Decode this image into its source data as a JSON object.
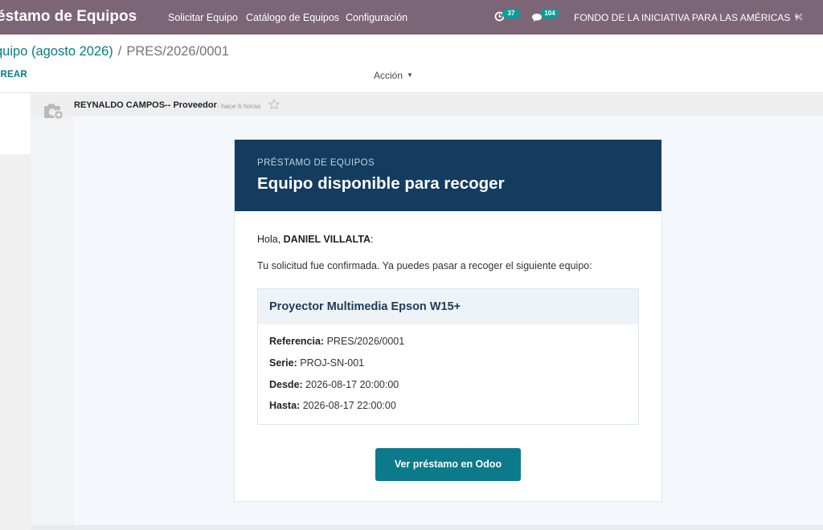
{
  "navbar": {
    "app_title": "éstamo de Equipos",
    "menu": [
      "Solicitar Equipo",
      "Catálogo de Equipos",
      "Configuración"
    ],
    "activity_count": "37",
    "messages_count": "104",
    "company": "FONDO DE LA INICIATIVA PARA LAS AMÉRICAS"
  },
  "control_panel": {
    "breadcrumb_parent": "quipo (agosto 2026)",
    "breadcrumb_separator": "/",
    "breadcrumb_current": "PRES/2026/0001",
    "create_label": "CREAR",
    "action_label": "Acción"
  },
  "message": {
    "author": "REYNALDO CAMPOS-- Proveedor",
    "time": "- hace 6 horas"
  },
  "email": {
    "eyebrow": "PRÉSTAMO DE EQUIPOS",
    "title": "Equipo disponible para recoger",
    "greeting_prefix": "Hola, ",
    "recipient": "DANIEL VILLALTA",
    "greeting_suffix": ":",
    "intro": "Tu solicitud fue confirmada. Ya puedes pasar a recoger el siguiente equipo:",
    "item_name": "Proyector Multimedia Epson W15+",
    "details": [
      {
        "label": "Referencia:",
        "value": "PRES/2026/0001"
      },
      {
        "label": "Serie:",
        "value": "PROJ-SN-001"
      },
      {
        "label": "Desde:",
        "value": "2026-08-17 20:00:00"
      },
      {
        "label": "Hasta:",
        "value": "2026-08-17 22:00:00"
      }
    ],
    "button_label": "Ver préstamo en Odoo"
  },
  "colors": {
    "navbar": "#7c6577",
    "accent_teal": "#017e84",
    "email_header": "#143c5f",
    "cta_button": "#0c7a8a",
    "badge": "#00a09d"
  },
  "icons": [
    "activity-clock-icon",
    "chat-bubble-icon",
    "close-icon",
    "camera-avatar-icon",
    "star-icon"
  ]
}
